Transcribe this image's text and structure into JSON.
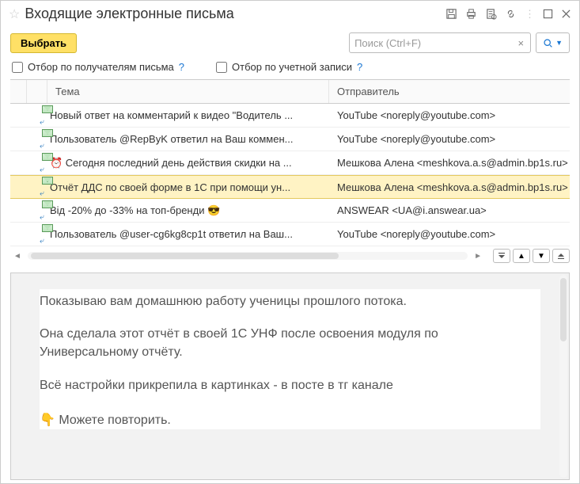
{
  "title": "Входящие электронные письма",
  "toolbar": {
    "select_label": "Выбрать"
  },
  "search": {
    "placeholder": "Поиск (Ctrl+F)"
  },
  "filters": {
    "by_recipients": "Отбор по получателям письма",
    "by_account": "Отбор по учетной записи"
  },
  "columns": {
    "subject": "Тема",
    "sender": "Отправитель"
  },
  "rows": [
    {
      "subject": "Новый ответ на комментарий к видео \"Водитель ...",
      "sender": "YouTube <noreply@youtube.com>",
      "selected": false
    },
    {
      "subject": "Пользователь @RepByK ответил на Ваш коммен...",
      "sender": "YouTube <noreply@youtube.com>",
      "selected": false
    },
    {
      "subject": "⏰ Сегодня последний день действия скидки на ...",
      "sender": "Мешкова Алена <meshkova.a.s@admin.bp1s.ru>",
      "selected": false
    },
    {
      "subject": "Отчёт ДДС по своей форме в 1С при помощи ун...",
      "sender": "Мешкова Алена <meshkova.a.s@admin.bp1s.ru>",
      "selected": true
    },
    {
      "subject": "Від -20% до -33% на топ-бренди 😎",
      "sender": "ANSWEAR <UA@i.answear.ua>",
      "selected": false
    },
    {
      "subject": "Пользователь @user-cg6kg8cp1t ответил на Ваш...",
      "sender": "YouTube <noreply@youtube.com>",
      "selected": false
    }
  ],
  "preview": {
    "p1": "Показываю вам домашнюю работу ученицы прошлого потока.",
    "p2": "Она сделала этот отчёт в своей 1С УНФ после освоения модуля по Универсальному отчёту.",
    "p3": "Всё настройки прикрепила в картинках - в посте в тг канале",
    "p4": "👇 Можете повторить."
  }
}
